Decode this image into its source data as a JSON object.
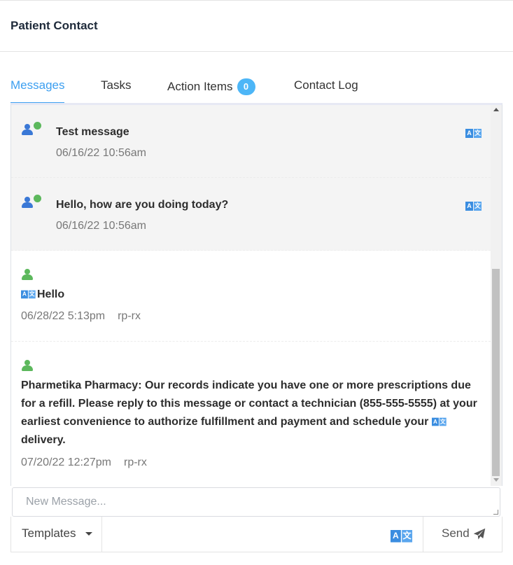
{
  "header": {
    "title": "Patient Contact"
  },
  "tabs": [
    {
      "label": "Messages",
      "active": true
    },
    {
      "label": "Tasks"
    },
    {
      "label": "Action Items",
      "badge": "0"
    },
    {
      "label": "Contact Log"
    }
  ],
  "messages": [
    {
      "direction": "outgoing",
      "text": "Test message",
      "time": "06/16/22 10:56am"
    },
    {
      "direction": "outgoing",
      "text": "Hello, how are you doing today?",
      "time": "06/16/22 10:56am"
    },
    {
      "direction": "incoming",
      "text": "Hello",
      "time": "06/28/22 5:13pm",
      "user": "rp-rx"
    },
    {
      "direction": "incoming",
      "text": "Pharmetika Pharmacy: Our records indicate you have one or more prescriptions due for a refill. Please reply to this message or contact a technician (855-555-5555) at your earliest convenience to authorize fulfillment and payment and schedule your delivery.",
      "time": "07/20/22 12:27pm",
      "user": "rp-rx"
    }
  ],
  "translate_icon": {
    "name": "translate-icon",
    "glyph_a": "A",
    "glyph_b": "文"
  },
  "compose": {
    "placeholder": "New Message..."
  },
  "footer": {
    "templates_label": "Templates",
    "send_label": "Send"
  },
  "colors": {
    "accent": "#3c9ff0",
    "badge": "#4db6f7",
    "avatar_blue": "#3a78d6",
    "online_green": "#5cb85c"
  }
}
